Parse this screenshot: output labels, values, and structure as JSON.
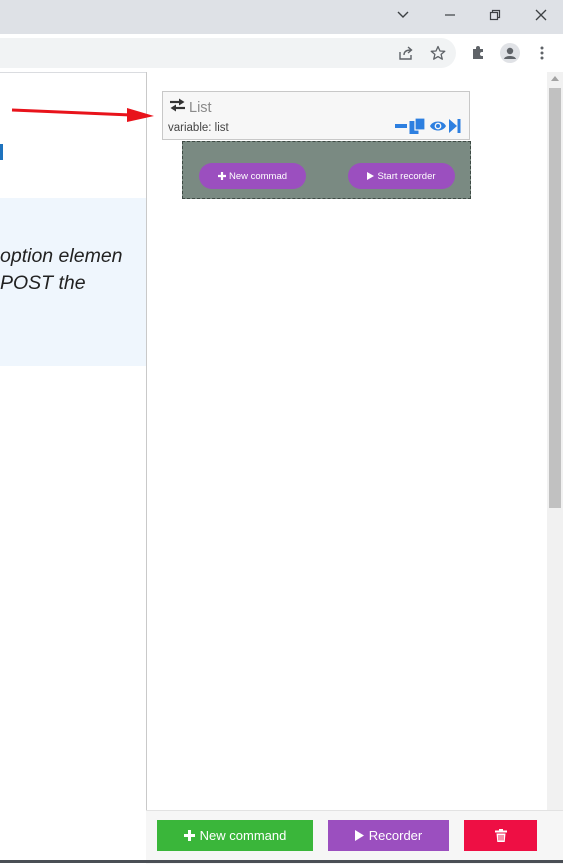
{
  "page": {
    "note_line1": "option elemen",
    "note_line2": "POST the"
  },
  "card": {
    "title": "List",
    "variable_label": "variable: list"
  },
  "dropzone": {
    "new_command_label": "New commad",
    "start_recorder_label": "Start recorder"
  },
  "footer": {
    "new_command_label": "New command",
    "recorder_label": "Recorder"
  },
  "colors": {
    "accent_blue": "#2d7fe0",
    "purple": "#9b4fbf",
    "green": "#3ab63a",
    "red": "#ee0f44",
    "dropzone_bg": "#7a8a82",
    "arrow_red": "#e8131b"
  }
}
